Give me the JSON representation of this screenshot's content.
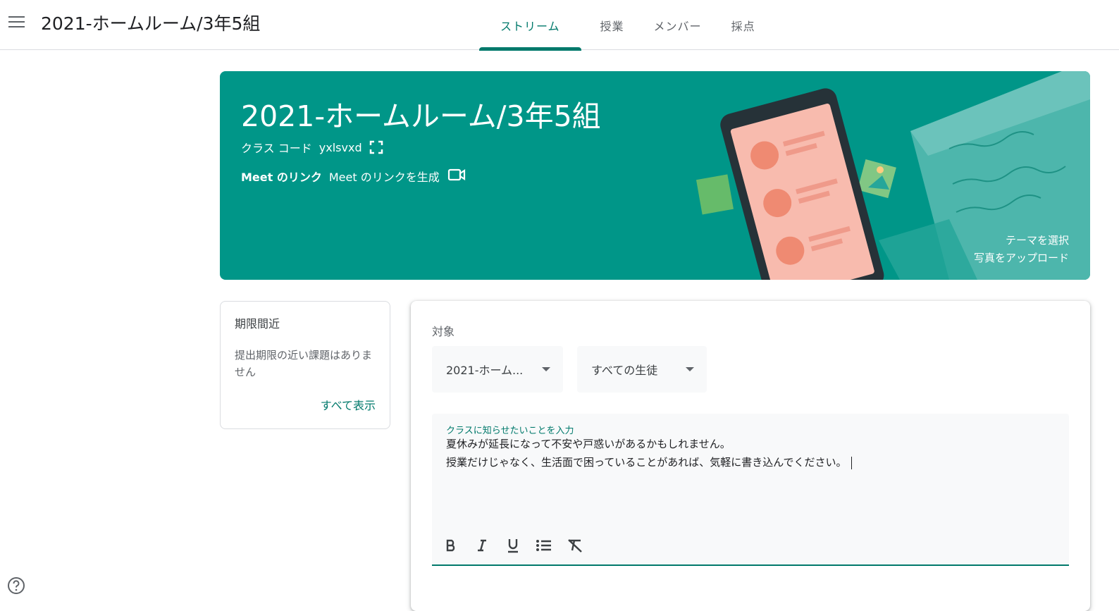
{
  "topbar": {
    "title": "2021-ホームルーム/3年5組",
    "tabs": [
      {
        "label": "ストリーム",
        "active": true
      },
      {
        "label": "授業",
        "active": false
      },
      {
        "label": "メンバー",
        "active": false
      },
      {
        "label": "採点",
        "active": false
      }
    ]
  },
  "banner": {
    "title": "2021-ホームルーム/3年5組",
    "class_code_label": "クラス コード",
    "class_code": "yxlsvxd",
    "meet_label": "Meet のリンク",
    "meet_generate": "Meet のリンクを生成",
    "select_theme": "テーマを選択",
    "upload_photo": "写真をアップロード",
    "color": "#009688"
  },
  "upcoming": {
    "title": "期限間近",
    "text": "提出期限の近い課題はありません",
    "view_all": "すべて表示"
  },
  "compose": {
    "target_label": "対象",
    "class_select": "2021-ホーム...",
    "student_select": "すべての生徒",
    "editor_label": "クラスに知らせたいことを入力",
    "editor_lines": [
      "夏休みが延長になって不安や戸惑いがあるかもしれません。",
      "授業だけじゃなく、生活面で困っていることがあれば、気軽に書き込んでください。"
    ],
    "format_icons": [
      "bold-icon",
      "italic-icon",
      "underline-icon",
      "bulleted-list-icon",
      "clear-formatting-icon"
    ]
  },
  "accent_color": "#00796b"
}
